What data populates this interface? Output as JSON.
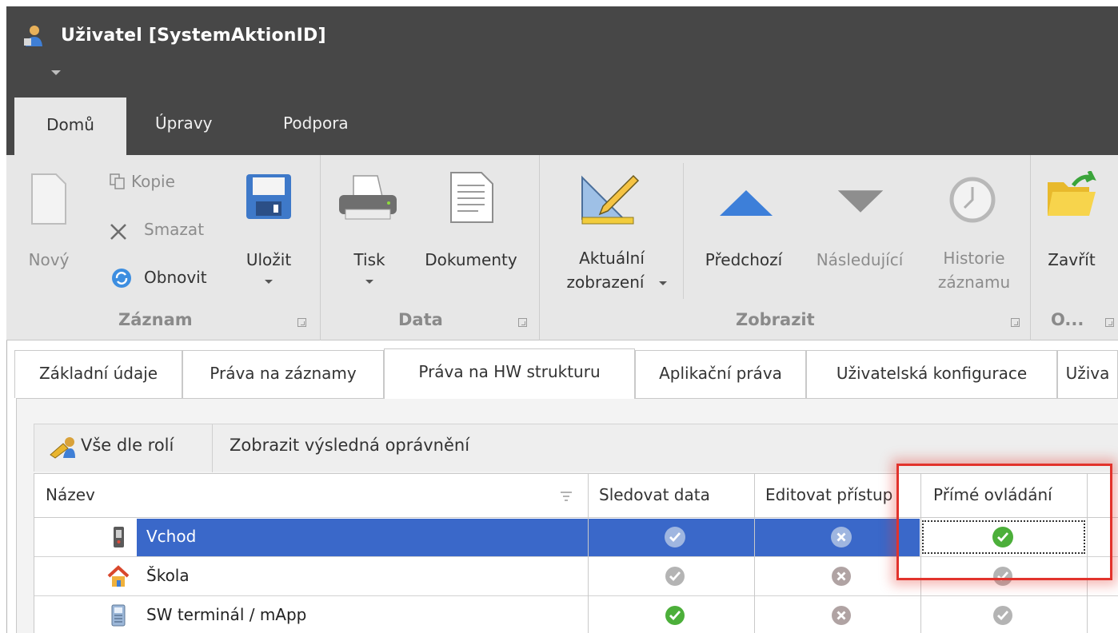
{
  "window": {
    "title": "Uživatel [SystemAktionID]"
  },
  "ribbon_tabs": [
    {
      "label": "Domů",
      "active": true
    },
    {
      "label": "Úpravy",
      "active": false
    },
    {
      "label": "Podpora",
      "active": false
    }
  ],
  "ribbon": {
    "zaznam": {
      "group_label": "Záznam",
      "new": "Nový",
      "copy": "Kopie",
      "delete": "Smazat",
      "refresh": "Obnovit",
      "save": "Uložit"
    },
    "data": {
      "group_label": "Data",
      "print": "Tisk",
      "documents": "Dokumenty"
    },
    "zobrazit": {
      "group_label": "Zobrazit",
      "current_view_line1": "Aktuální",
      "current_view_line2": "zobrazení",
      "previous": "Předchozí",
      "next": "Následující",
      "history_line1": "Historie",
      "history_line2": "záznamu"
    },
    "other": {
      "group_label": "O...",
      "close": "Zavřít"
    }
  },
  "page_tabs": [
    {
      "label": "Základní údaje",
      "active": false
    },
    {
      "label": "Práva na záznamy",
      "active": false
    },
    {
      "label": "Práva na HW strukturu",
      "active": true
    },
    {
      "label": "Aplikační práva",
      "active": false
    },
    {
      "label": "Uživatelská konfigurace",
      "active": false
    },
    {
      "label": "Uživa",
      "active": false
    }
  ],
  "toolbar": {
    "by_roles": "Vše dle rolí",
    "show_result": "Zobrazit výsledná oprávnění"
  },
  "grid": {
    "columns": [
      "Název",
      "Sledovat data",
      "Editovat přístup",
      "Přímé ovládání"
    ],
    "rows": [
      {
        "name": "Vchod",
        "icon": "door-reader-icon",
        "selected": true,
        "view": "granted-inherited",
        "edit": "denied",
        "direct": "granted"
      },
      {
        "name": "Škola",
        "icon": "house-icon",
        "selected": false,
        "view": "granted-inherited",
        "edit": "denied",
        "direct": "granted-inherited"
      },
      {
        "name": "SW terminál / mApp",
        "icon": "terminal-icon",
        "selected": false,
        "view": "granted",
        "edit": "denied",
        "direct": "granted-inherited"
      }
    ]
  },
  "colors": {
    "titlebar": "#474747",
    "ribbon": "#e7e7e7",
    "selection": "#3a68c9",
    "granted": "#4caf3a",
    "inherited": "#a9a9a9",
    "highlight": "#e2332c"
  }
}
